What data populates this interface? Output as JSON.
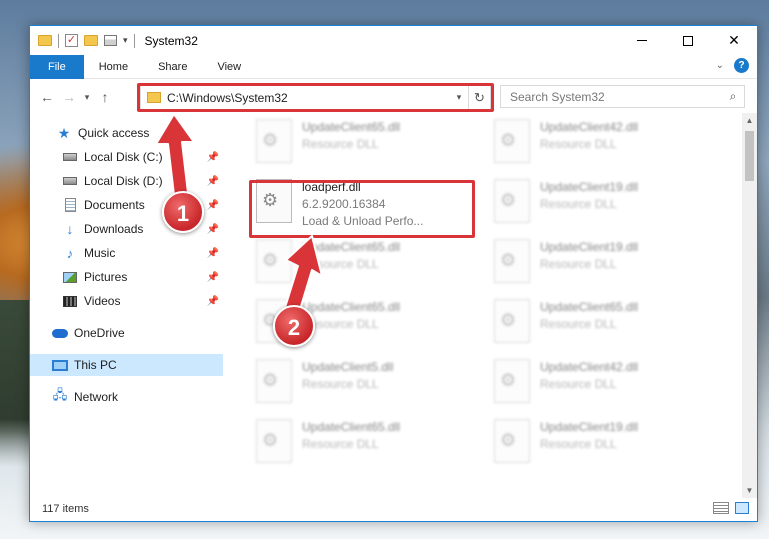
{
  "window": {
    "title": "System32"
  },
  "ribbon": {
    "tabs": [
      "File",
      "Home",
      "Share",
      "View"
    ],
    "help_label": "?"
  },
  "nav": {
    "address": "C:\\Windows\\System32",
    "search_placeholder": "Search System32"
  },
  "sidebar": {
    "items": [
      {
        "label": "Quick access",
        "icon": "star-icon",
        "pinned": false
      },
      {
        "label": "Local Disk (C:)",
        "icon": "drive-icon",
        "pinned": true
      },
      {
        "label": "Local Disk (D:)",
        "icon": "drive-icon",
        "pinned": true
      },
      {
        "label": "Documents",
        "icon": "documents-icon",
        "pinned": true
      },
      {
        "label": "Downloads",
        "icon": "download-icon",
        "pinned": true
      },
      {
        "label": "Music",
        "icon": "music-icon",
        "pinned": true
      },
      {
        "label": "Pictures",
        "icon": "pictures-icon",
        "pinned": true
      },
      {
        "label": "Videos",
        "icon": "videos-icon",
        "pinned": true
      },
      {
        "label": "OneDrive",
        "icon": "cloud-icon",
        "pinned": false
      },
      {
        "label": "This PC",
        "icon": "computer-icon",
        "pinned": false,
        "selected": true
      },
      {
        "label": "Network",
        "icon": "network-icon",
        "pinned": false
      }
    ]
  },
  "files": {
    "highlighted": {
      "name": "loadperf.dll",
      "version": "6.2.9200.16384",
      "description": "Load & Unload Perfo..."
    },
    "left_column": [
      {
        "name": "UpdateClient65.dll",
        "type": "Resource DLL"
      },
      {
        "name": "UpdateClient65.dll",
        "type": "Resource DLL"
      },
      {
        "name": "UpdateClient65.dll",
        "type": "Resource DLL"
      },
      {
        "name": "UpdateClient5.dll",
        "type": "Resource DLL"
      },
      {
        "name": "UpdateClient65.dll",
        "type": "Resource DLL"
      }
    ],
    "right_column": [
      {
        "name": "UpdateClient42.dll",
        "type": "Resource DLL"
      },
      {
        "name": "UpdateClient19.dll",
        "type": "Resource DLL"
      },
      {
        "name": "UpdateClient19.dll",
        "type": "Resource DLL"
      },
      {
        "name": "UpdateClient65.dll",
        "type": "Resource DLL"
      },
      {
        "name": "UpdateClient42.dll",
        "type": "Resource DLL"
      },
      {
        "name": "UpdateClient19.dll",
        "type": "Resource DLL"
      }
    ]
  },
  "status": {
    "item_count": "117 items"
  },
  "callouts": [
    "1",
    "2"
  ],
  "colors": {
    "accent": "#1979ca",
    "highlight": "#d93438",
    "selection": "#cce8ff"
  }
}
